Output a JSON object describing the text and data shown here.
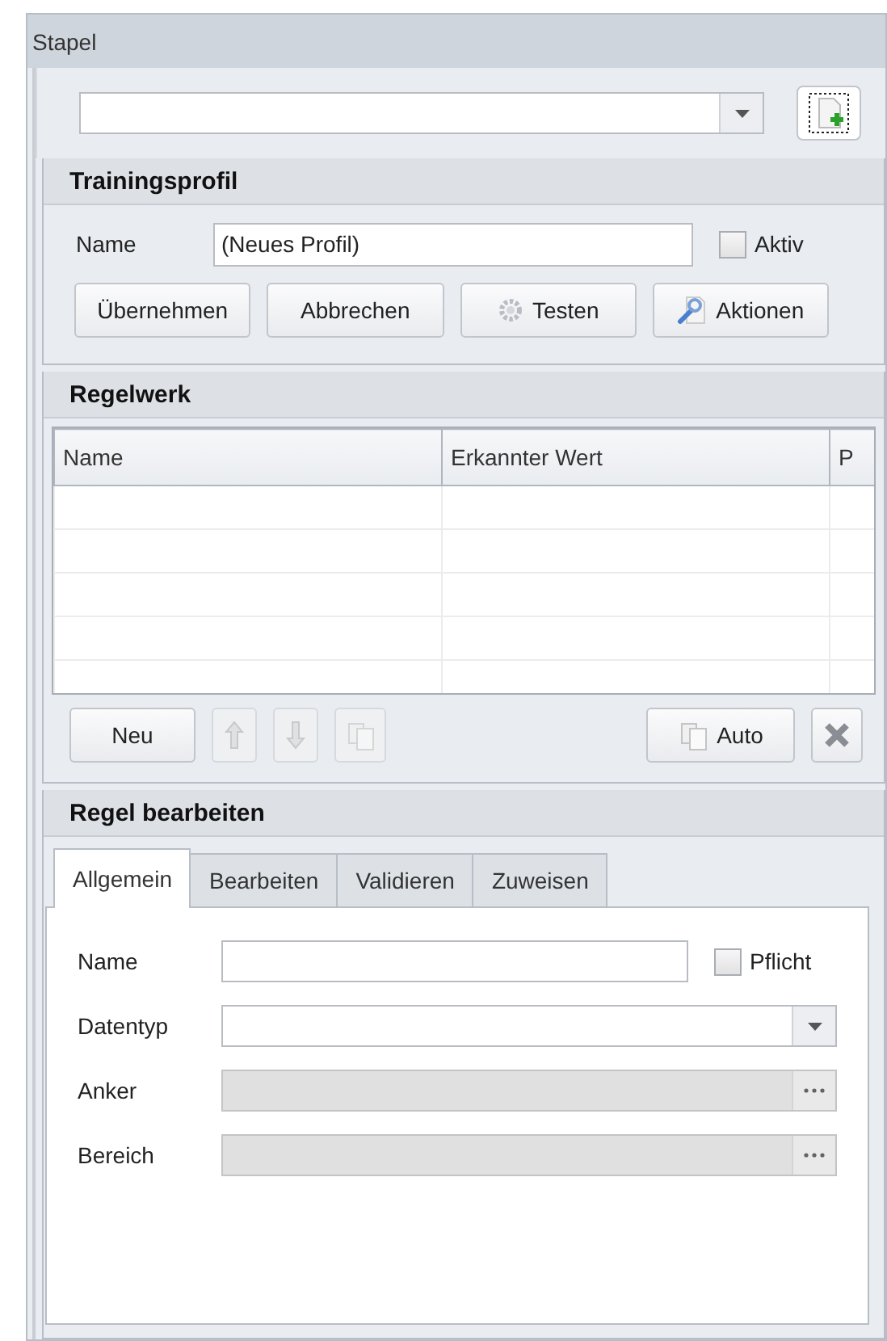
{
  "window": {
    "title": "Stapel"
  },
  "trainingsprofil": {
    "title": "Trainingsprofil",
    "name_label": "Name",
    "name_value": "(Neues Profil)",
    "aktiv": {
      "label": "Aktiv",
      "checked": false
    },
    "buttons": [
      {
        "label": "Übernehmen",
        "kind": "plain",
        "disabled": false
      },
      {
        "label": "Abbrechen",
        "kind": "plain",
        "disabled": false
      },
      {
        "label": "Testen",
        "kind": "gear",
        "disabled": false
      },
      {
        "label": "Aktionen",
        "kind": "wrench",
        "disabled": false
      }
    ]
  },
  "regelwerk": {
    "title": "Regelwerk",
    "table": {
      "columns": [
        "Name",
        "Erkannter Wert",
        "P"
      ]
    },
    "buttons": [
      {
        "label": "Neu",
        "kind": "plain",
        "disabled": false
      },
      {
        "kind": "up",
        "disabled": true
      },
      {
        "kind": "down",
        "disabled": true
      },
      {
        "kind": "copy",
        "disabled": true
      },
      {
        "label": "Auto",
        "kind": "copy",
        "disabled": false
      },
      {
        "kind": "delete",
        "disabled": false
      }
    ]
  },
  "regel_bearbeiten": {
    "title": "Regel bearbeiten",
    "tabs": [
      {
        "label": "Allgemein",
        "selected": true
      },
      {
        "label": "Bearbeiten",
        "selected": false
      },
      {
        "label": "Validieren",
        "selected": false
      },
      {
        "label": "Zuweisen",
        "selected": false
      }
    ],
    "fields": [
      {
        "label": "Name",
        "kind": "text",
        "disabled": false,
        "checkbox": {
          "label": "Pflicht",
          "checked": false
        }
      },
      {
        "label": "Datentyp",
        "kind": "combo",
        "disabled": false
      },
      {
        "label": "Anker",
        "kind": "browse",
        "disabled": true
      },
      {
        "label": "Bereich",
        "kind": "browse",
        "disabled": true
      }
    ]
  }
}
